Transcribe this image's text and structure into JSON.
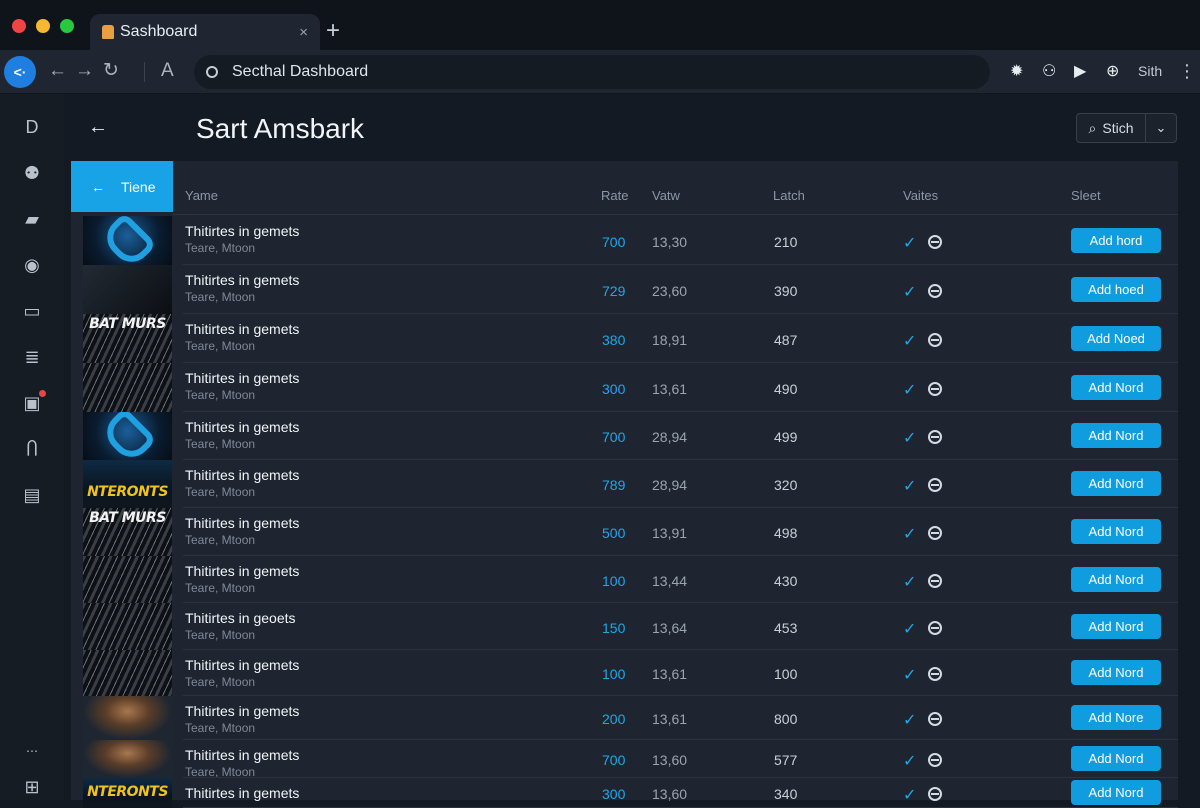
{
  "browser": {
    "tab_title": "Sashboard",
    "tab_close": "×",
    "new_tab": "+",
    "address": "Secthal Dashboard",
    "profile_label": "Sith",
    "menu": "⋮",
    "back": "←",
    "forward": "→",
    "reload": "↻",
    "reader": "A"
  },
  "header": {
    "back": "←",
    "title": "Sart Amsbark",
    "search_label": "Stich",
    "search_icon": "⌕",
    "dropdown_icon": "⌄"
  },
  "filter_tab": {
    "arrow": "←",
    "label": "Tiene"
  },
  "columns": {
    "name": "Yame",
    "rate": "Rate",
    "value": "Vatw",
    "latch": "Latch",
    "status": "Vaites",
    "select": "Sleet"
  },
  "rows": [
    {
      "title": "Thitirtes in gemets",
      "subtitle": "Teare, Mtoon",
      "rate": "700",
      "value": "13,30",
      "latch": "210",
      "action": "Add hord",
      "thumb_style": "blue",
      "thumb_text": ""
    },
    {
      "title": "Thitirtes in gemets",
      "subtitle": "Teare, Mtoon",
      "rate": "729",
      "value": "23,60",
      "latch": "390",
      "action": "Add hoed",
      "thumb_style": "dark",
      "thumb_text": ""
    },
    {
      "title": "Thitirtes in gemets",
      "subtitle": "Teare, Mtoon",
      "rate": "380",
      "value": "18,91",
      "latch": "487",
      "action": "Add Noed",
      "thumb_style": "grit",
      "thumb_text": "BAT MURS"
    },
    {
      "title": "Thitirtes in gemets",
      "subtitle": "Teare, Mtoon",
      "rate": "300",
      "value": "13,61",
      "latch": "490",
      "action": "Add Nord",
      "thumb_style": "grit",
      "thumb_text": ""
    },
    {
      "title": "Thitirtes in gemets",
      "subtitle": "Teare, Mtoon",
      "rate": "700",
      "value": "28,94",
      "latch": "499",
      "action": "Add Nord",
      "thumb_style": "blue",
      "thumb_text": ""
    },
    {
      "title": "Thitirtes in gemets",
      "subtitle": "Teare, Mtoon",
      "rate": "789",
      "value": "28,94",
      "latch": "320",
      "action": "Add Nord",
      "thumb_style": "yellow",
      "thumb_text": "NTERONTS"
    },
    {
      "title": "Thitirtes in gemets",
      "subtitle": "Teare, Mtoon",
      "rate": "500",
      "value": "13,91",
      "latch": "498",
      "action": "Add Nord",
      "thumb_style": "grit",
      "thumb_text": "BAT MURS"
    },
    {
      "title": "Thitirtes in gemets",
      "subtitle": "Teare, Mtoon",
      "rate": "100",
      "value": "13,44",
      "latch": "430",
      "action": "Add Nord",
      "thumb_style": "grit",
      "thumb_text": ""
    },
    {
      "title": "Thitirtes in geoets",
      "subtitle": "Teare, Mtoon",
      "rate": "150",
      "value": "13,64",
      "latch": "453",
      "action": "Add Nord",
      "thumb_style": "grit",
      "thumb_text": ""
    },
    {
      "title": "Thitirtes in gemets",
      "subtitle": "Teare, Mtoon",
      "rate": "100",
      "value": "13,61",
      "latch": "100",
      "action": "Add Nord",
      "thumb_style": "grit",
      "thumb_text": ""
    },
    {
      "title": "Thitirtes in gemets",
      "subtitle": "Teare, Mtoon",
      "rate": "200",
      "value": "13,61",
      "latch": "800",
      "action": "Add Nore",
      "thumb_style": "person",
      "thumb_text": ""
    },
    {
      "title": "Thitirtes in gemets",
      "subtitle": "Teare, Mtoon",
      "rate": "700",
      "value": "13,60",
      "latch": "577",
      "action": "Add Nord",
      "thumb_style": "person",
      "thumb_text": ""
    },
    {
      "title": "Thitirtes in gemets",
      "subtitle": "",
      "rate": "300",
      "value": "13,60",
      "latch": "340",
      "action": "Add Nord",
      "thumb_style": "yellow",
      "thumb_text": "NTERONTS"
    }
  ],
  "colors": {
    "accent": "#18a3e6",
    "background": "#141a23",
    "panel": "#1e2530"
  },
  "icons": {
    "rail": [
      "logo-icon",
      "users-icon",
      "folder-icon",
      "compass-icon",
      "calendar-icon",
      "list-icon",
      "notes-icon",
      "profile-icon",
      "stats-icon",
      "more-icon",
      "settings-icon"
    ]
  }
}
